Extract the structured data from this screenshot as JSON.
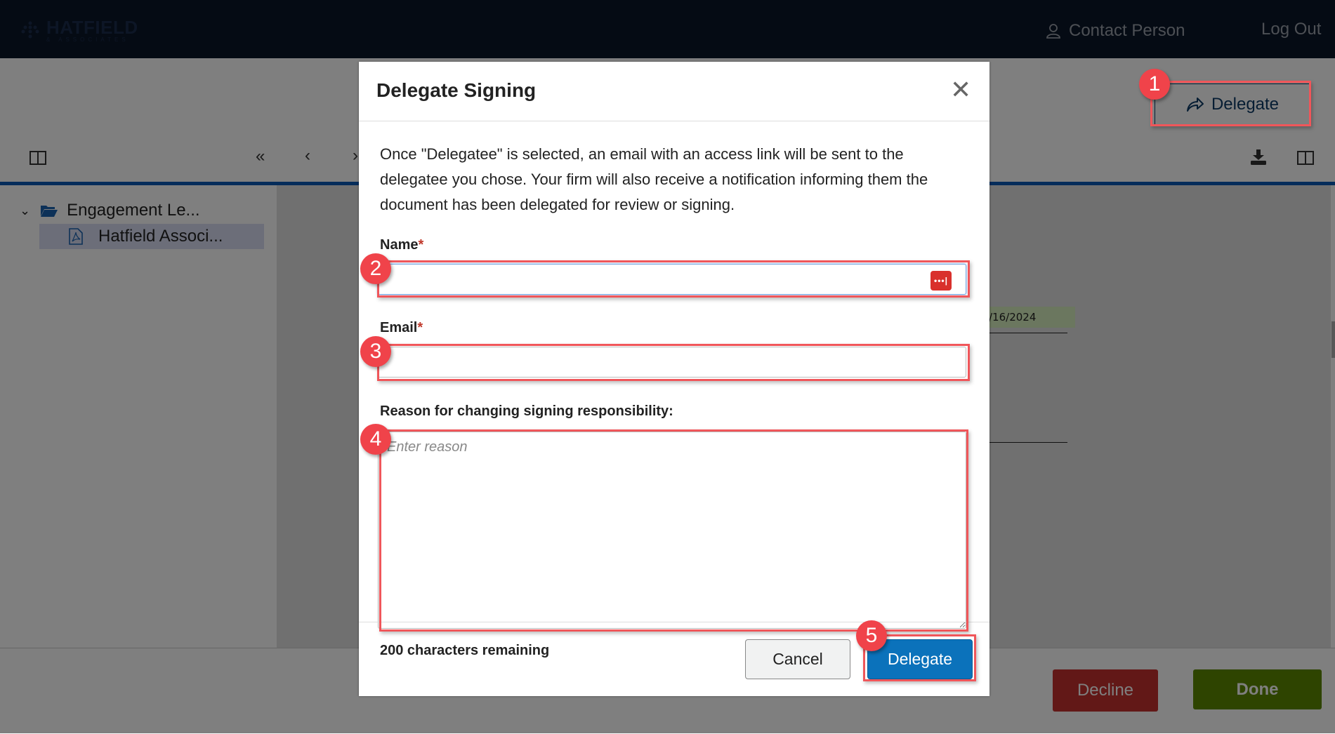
{
  "header": {
    "logo_text": "HATFIELD",
    "logo_subtext": "& ASSOCIATES",
    "contact_label": "Contact Person",
    "logout_label": "Log Out"
  },
  "actions": {
    "delegate_label": "Delegate"
  },
  "sidebar": {
    "folder_label": "Engagement Le...",
    "file_label": "Hatfield Associ..."
  },
  "document": {
    "date_fragment": "/16/2024"
  },
  "bottom_bar": {
    "decline_label": "Decline",
    "done_label": "Done"
  },
  "modal": {
    "title": "Delegate Signing",
    "description": "Once \"Delegatee\" is selected, an email with an access link will be sent to the delegatee you chose. Your firm will also receive a notification informing them the document has been delegated for review or signing.",
    "name_label": "Name",
    "name_value": "",
    "email_label": "Email",
    "email_value": "",
    "required_marker": "*",
    "reason_label": "Reason for changing signing responsibility:",
    "reason_placeholder": "Enter reason",
    "chars_remaining": "200 characters remaining",
    "cancel_label": "Cancel",
    "submit_label": "Delegate"
  },
  "annotations": [
    "1",
    "2",
    "3",
    "4",
    "5"
  ],
  "colors": {
    "header_bg": "#0b1628",
    "accent_blue": "#0b72bb",
    "toolbar_line": "#0a59b5",
    "decline_red": "#c5302f",
    "done_green": "#5c8800",
    "annotation_red": "#f0434a"
  }
}
